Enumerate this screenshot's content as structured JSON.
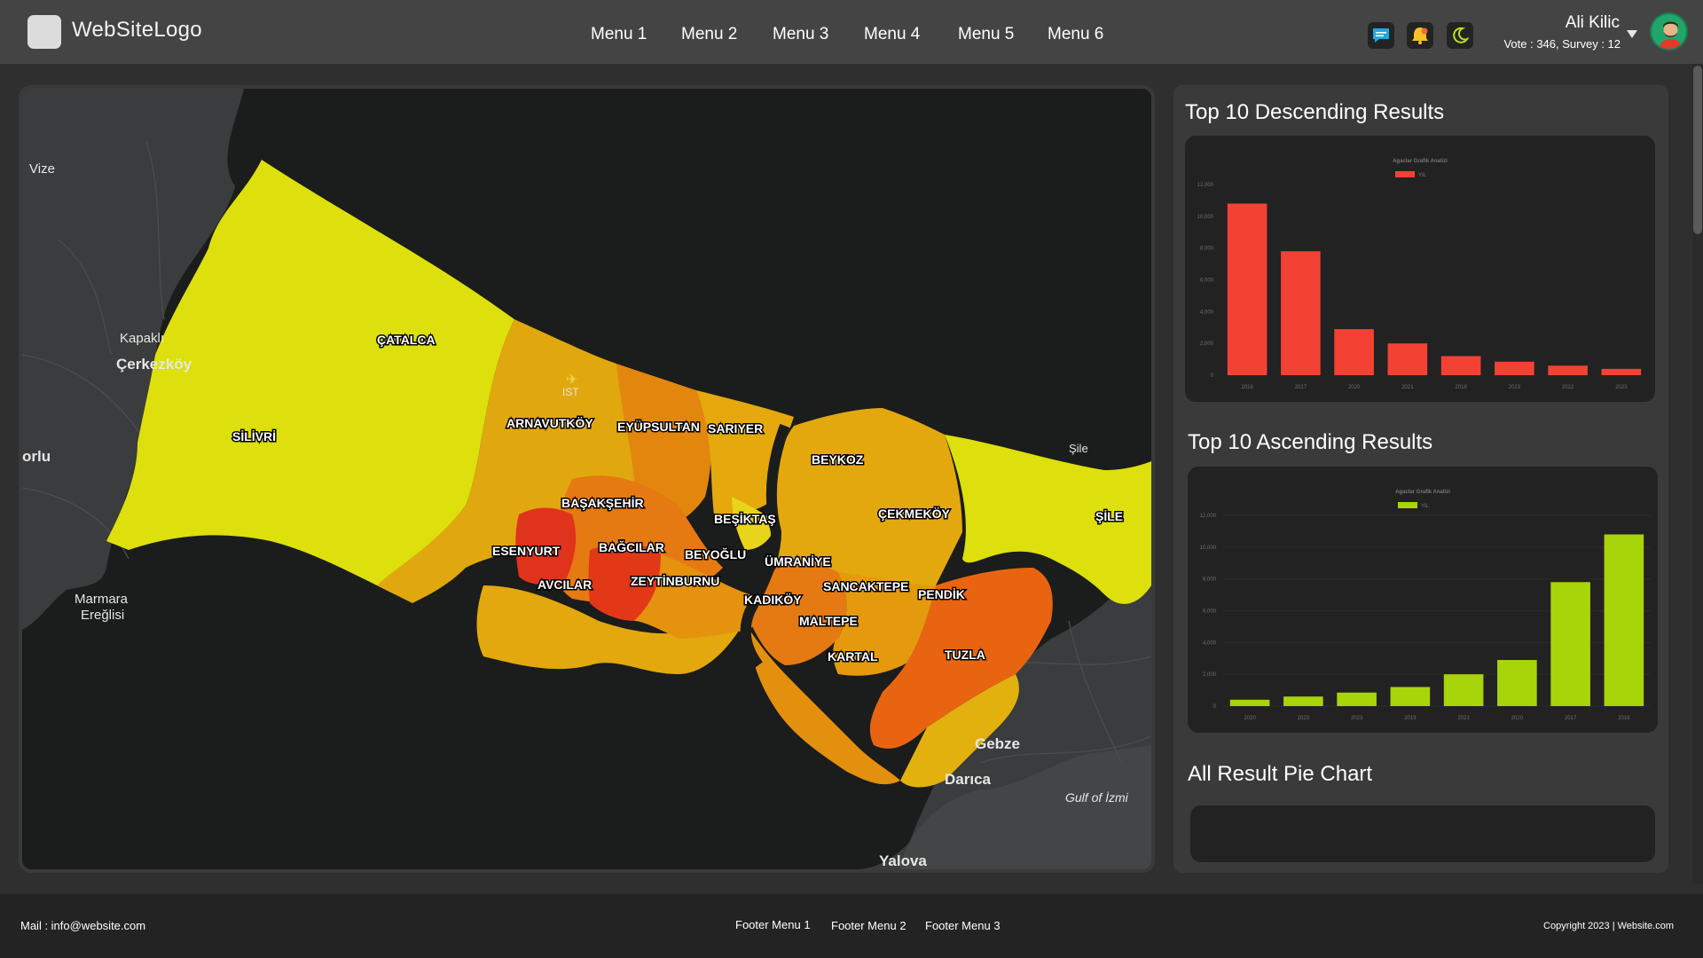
{
  "header": {
    "logo_text": "WebSiteLogo",
    "nav": [
      "Menu 1",
      "Menu 2",
      "Menu 3",
      "Menu 4",
      "Menu 5",
      "Menu 6"
    ],
    "icons": [
      "chat-icon",
      "bell-icon",
      "moon-icon"
    ],
    "user": {
      "name": "Ali Kilic",
      "stats": "Vote : 346, Survey : 12"
    }
  },
  "map": {
    "districts": [
      "ÇATALCA",
      "SİLİVRİ",
      "ARNAVUTKÖY",
      "EYÜPSULTAN",
      "SARIYER",
      "BEYKOZ",
      "BAŞAKŞEHİR",
      "BEŞİKTAŞ",
      "ESENYURT",
      "BAĞCILAR",
      "BEYOĞLU",
      "ÜMRANİYE",
      "ÇEKMEKÖY",
      "ŞİLE",
      "AVCILAR",
      "ZEYTİNBURNU",
      "KADIKÖY",
      "SANCAKTEPE",
      "PENDİK",
      "MALTEPE",
      "KARTAL",
      "TUZLA"
    ],
    "places": [
      "Vize",
      "Kapaklı",
      "Çerkezköy",
      "orlu",
      "Marmara",
      "Ereğlisi",
      "Gebze",
      "Darıca",
      "Yalova",
      "Gulf of İzmi",
      "IST",
      "Şile"
    ]
  },
  "sections": {
    "descending_title": "Top 10 Descending Results",
    "ascending_title": "Top 10 Ascending Results",
    "pie_title": "All Result Pie Chart"
  },
  "chart_data": [
    {
      "type": "bar",
      "title": "Agaclar Grafik Analizi",
      "legend": "YIL",
      "color": "#f34234",
      "categories": [
        "2016",
        "2017",
        "2020",
        "2021",
        "2018",
        "2023",
        "2022",
        "2023"
      ],
      "values": [
        10800,
        7800,
        2900,
        2000,
        1200,
        850,
        600,
        400
      ],
      "ylim": [
        0,
        12000
      ],
      "yticks": [
        "0",
        "2,000",
        "4,000",
        "6,000",
        "8,000",
        "10,000",
        "12,000"
      ]
    },
    {
      "type": "bar",
      "title": "Agaclar Grafik Analizi",
      "legend": "YIL",
      "color": "#a8d40a",
      "categories": [
        "2020",
        "2023",
        "2023",
        "2019",
        "2021",
        "2020",
        "2017",
        "2016"
      ],
      "values": [
        400,
        600,
        850,
        1200,
        2000,
        2900,
        7800,
        10800
      ],
      "ylim": [
        0,
        12000
      ],
      "yticks": [
        "0",
        "2,000",
        "4,000",
        "6,000",
        "8,000",
        "10,000",
        "12,000"
      ]
    }
  ],
  "footer": {
    "mail": "Mail :  info@website.com",
    "links": [
      "Footer Menu 1",
      "Footer Menu 2",
      "Footer Menu 3"
    ],
    "copyright": "Copyright 2023 | Website.com"
  }
}
